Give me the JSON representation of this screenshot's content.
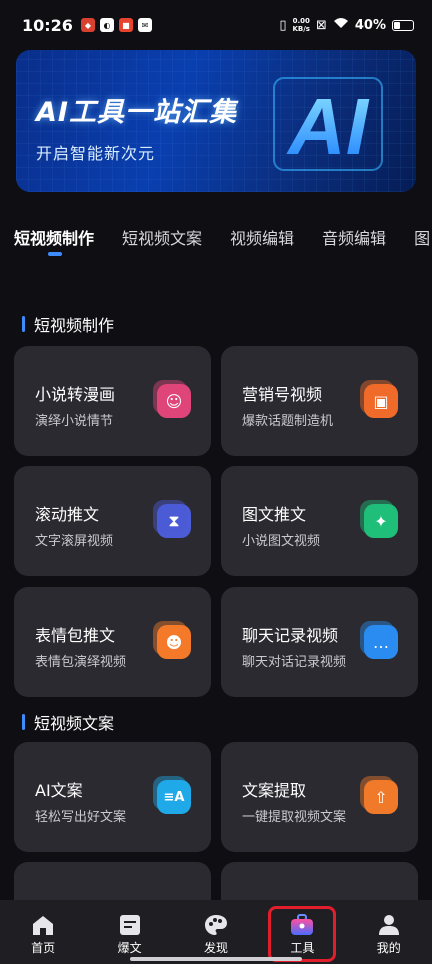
{
  "status_bar": {
    "time": "10:26",
    "speed_top": "0.00",
    "speed_bottom": "KB/s",
    "battery": "40%"
  },
  "banner": {
    "title": "AI工具一站汇集",
    "subtitle": "开启智能新次元",
    "logo_text": "AI"
  },
  "tabs": [
    "短视频制作",
    "短视频文案",
    "视频编辑",
    "音频编辑",
    "图"
  ],
  "sections": [
    {
      "title": "短视频制作",
      "cards": [
        {
          "title": "小说转漫画",
          "subtitle": "演绎小说情节",
          "icon": "face-icon",
          "color": "#e0457a"
        },
        {
          "title": "营销号视频",
          "subtitle": "爆款话题制造机",
          "icon": "film-icon",
          "color": "#f06a2a"
        },
        {
          "title": "滚动推文",
          "subtitle": "文字滚屏视频",
          "icon": "hourglass-icon",
          "color": "#4b5cd6"
        },
        {
          "title": "图文推文",
          "subtitle": "小说图文视频",
          "icon": "image-sparkle-icon",
          "color": "#1fbf7a"
        },
        {
          "title": "表情包推文",
          "subtitle": "表情包演绎视频",
          "icon": "smiley-icon",
          "color": "#f47a2a"
        },
        {
          "title": "聊天记录视频",
          "subtitle": "聊天对话记录视频",
          "icon": "chat-icon",
          "color": "#2a8cf0"
        }
      ]
    },
    {
      "title": "短视频文案",
      "cards": [
        {
          "title": "AI文案",
          "subtitle": "轻松写出好文案",
          "icon": "ai-text-icon",
          "color": "#20a9e8"
        },
        {
          "title": "文案提取",
          "subtitle": "一键提取视频文案",
          "icon": "upload-icon",
          "color": "#f07a2a"
        }
      ]
    }
  ],
  "bottom_nav": [
    {
      "label": "首页",
      "icon": "home-icon"
    },
    {
      "label": "爆文",
      "icon": "document-icon"
    },
    {
      "label": "发现",
      "icon": "palette-icon"
    },
    {
      "label": "工具",
      "icon": "toolbox-icon",
      "active": true
    },
    {
      "label": "我的",
      "icon": "user-icon"
    }
  ],
  "colors": {
    "accent": "#3d8bfd",
    "highlight": "#e01e2c",
    "card_bg": "#2a2a30"
  }
}
